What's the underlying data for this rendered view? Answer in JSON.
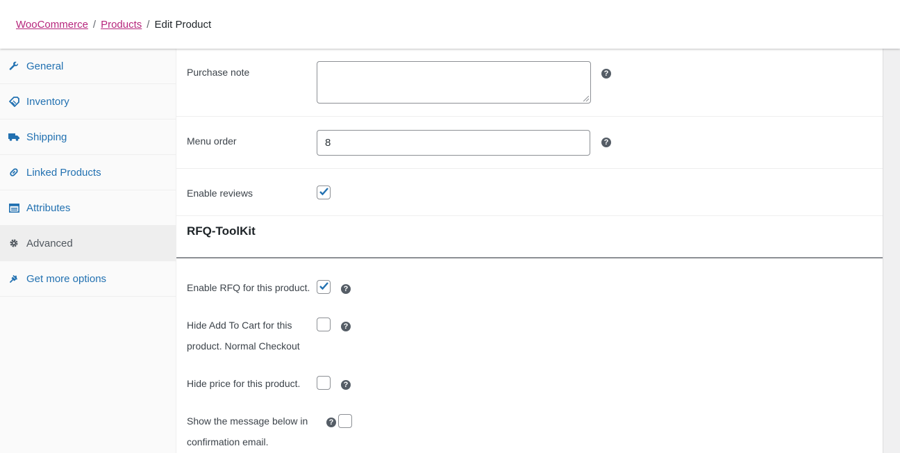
{
  "breadcrumb": {
    "items": [
      "WooCommerce",
      "Products"
    ],
    "current": "Edit Product",
    "separator": "/"
  },
  "sidebar": {
    "tabs": [
      {
        "label": "General",
        "icon": "wrench-icon"
      },
      {
        "label": "Inventory",
        "icon": "tag-icon"
      },
      {
        "label": "Shipping",
        "icon": "truck-icon"
      },
      {
        "label": "Linked Products",
        "icon": "link-icon"
      },
      {
        "label": "Attributes",
        "icon": "list-icon"
      },
      {
        "label": "Advanced",
        "icon": "gear-icon",
        "active": true
      },
      {
        "label": "Get more options",
        "icon": "plugin-icon"
      }
    ]
  },
  "advanced": {
    "purchase_note_label": "Purchase note",
    "purchase_note_value": "",
    "menu_order_label": "Menu order",
    "menu_order_value": "8",
    "enable_reviews_label": "Enable reviews",
    "enable_reviews_checked": true
  },
  "rfq": {
    "title": "RFQ-ToolKit",
    "enable_rfq_label": "Enable RFQ for this product.",
    "enable_rfq_checked": true,
    "hide_add_to_cart_line1": "Hide Add To Cart for this",
    "hide_add_to_cart_line2": "product. Normal Checkout",
    "hide_add_to_cart_checked": false,
    "hide_price_label": "Hide price for this product.",
    "hide_price_checked": false,
    "show_message_line1": "Show the message below in",
    "show_message_line2": "confirmation email.",
    "show_message_checked": false
  },
  "help_glyph": "?",
  "colors": {
    "link": "#2271b1",
    "breadcrumb_link": "#b6267c",
    "check": "#2271b1"
  }
}
